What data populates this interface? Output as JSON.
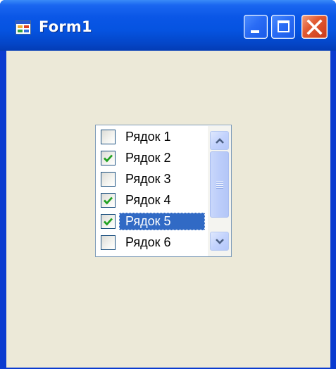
{
  "window": {
    "title": "Form1",
    "icon": "form-app-icon",
    "controls": {
      "minimize": "minimize-icon",
      "maximize": "maximize-icon",
      "close": "close-icon"
    }
  },
  "checked_list": {
    "items": [
      {
        "label": "Рядок 1",
        "checked": false,
        "selected": false
      },
      {
        "label": "Рядок 2",
        "checked": true,
        "selected": false
      },
      {
        "label": "Рядок 3",
        "checked": false,
        "selected": false
      },
      {
        "label": "Рядок 4",
        "checked": true,
        "selected": false
      },
      {
        "label": "Рядок 5",
        "checked": true,
        "selected": true
      },
      {
        "label": "Рядок 6",
        "checked": false,
        "selected": false
      }
    ],
    "scrollbar": {
      "up_icon": "chevron-up-icon",
      "down_icon": "chevron-down-icon"
    }
  },
  "colors": {
    "titlebar": "#0553e0",
    "client_background": "#ece9d8",
    "selection": "#316ac5",
    "checkmark": "#21a121"
  }
}
